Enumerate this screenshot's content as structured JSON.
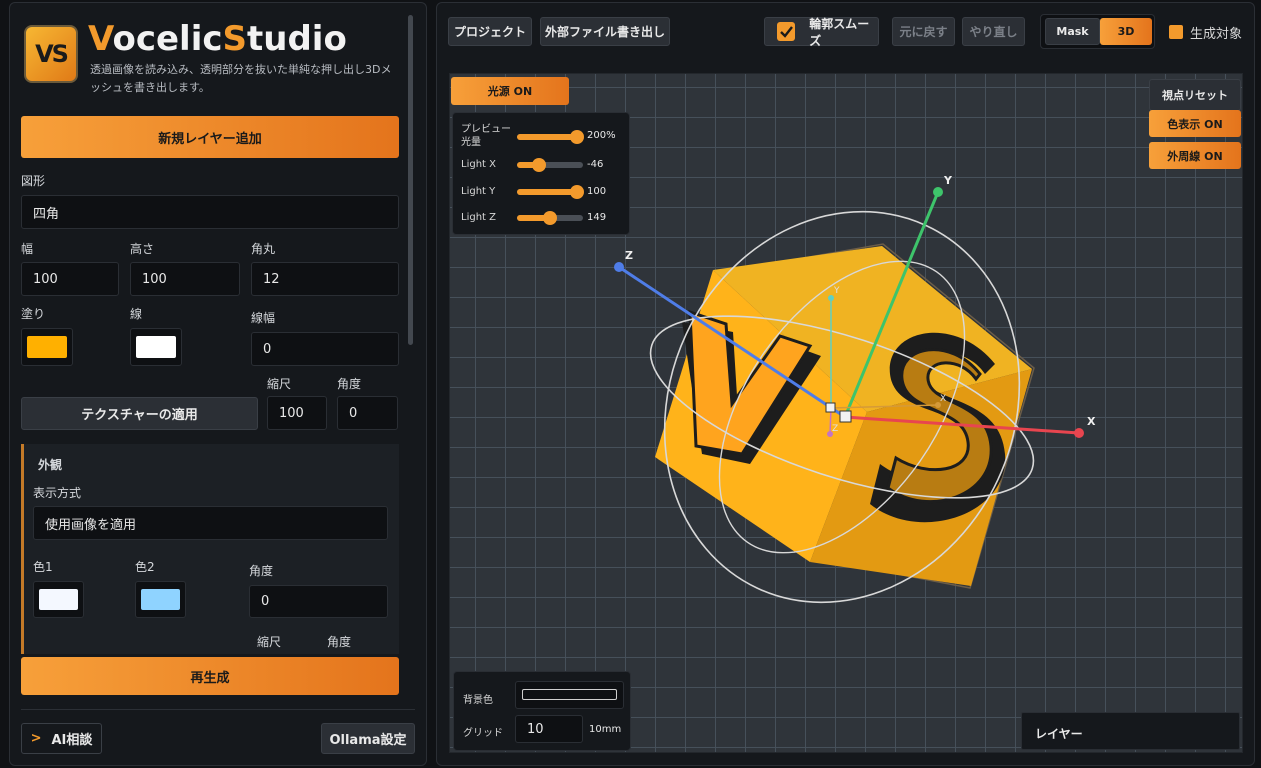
{
  "app": {
    "brand_v": "V",
    "brand_mid": "ocelic",
    "brand_s": "S",
    "brand_end": "tudio",
    "logo_text": "VS",
    "tagline": "透過画像を読み込み、透明部分を抜いた単純な押し出し3Dメッシュを書き出します。"
  },
  "left": {
    "add_layer_button": "新規レイヤー追加",
    "shape_label": "図形",
    "shape_value": "四角",
    "width_label": "幅",
    "width_value": "100",
    "height_label": "高さ",
    "height_value": "100",
    "radius_label": "角丸",
    "radius_value": "12",
    "fill_label": "塗り",
    "stroke_label": "線",
    "stroke_width_label": "線幅",
    "stroke_width_value": "0",
    "scale_label": "縮尺",
    "angle_label": "角度",
    "apply_texture_button": "テクスチャーの適用",
    "texture_scale_value": "100",
    "texture_angle_value": "0",
    "appearance": {
      "title": "外観",
      "display_mode_label": "表示方式",
      "display_mode_value": "使用画像を適用",
      "color1_label": "色1",
      "color2_label": "色2",
      "angle_label": "角度",
      "angle_value": "0",
      "scale_label": "縮尺",
      "angle2_label": "角度"
    },
    "regenerate_button": "再生成",
    "ai_button_prefix": ">",
    "ai_button_label": "AI相談",
    "ollama_button": "Ollama設定"
  },
  "toolbar": {
    "project_button": "プロジェクト",
    "export_button": "外部ファイル書き出し",
    "smooth_label": "輪郭スムーズ",
    "undo_button": "元に戻す",
    "redo_button": "やり直し",
    "mask_button": "Mask",
    "3d_button": "3D",
    "generate_target_label": "生成対象"
  },
  "viewport": {
    "light_toggle": "光源 ON",
    "preview_light_label": "プレビュー光量",
    "preview_light_value": "200%",
    "preview_light_level": 1.0,
    "light_x_label": "Light X",
    "light_x_value": "-46",
    "light_x_level": 0.33,
    "light_y_label": "Light Y",
    "light_y_value": "100",
    "light_y_level": 1.0,
    "light_z_label": "Light Z",
    "light_z_value": "149",
    "light_z_level": 0.5,
    "reset_view_button": "視点リセット",
    "color_display_button": "色表示 ON",
    "outline_button": "外周線 ON",
    "bg_color_label": "背景色",
    "grid_label": "グリッド",
    "grid_value": "10",
    "grid_unit": "10mm",
    "layers_title": "レイヤー",
    "axis_x": "X",
    "axis_y": "Y",
    "axis_z": "Z",
    "axis_x_small": "X",
    "axis_y_small": "Y",
    "axis_z_small": "Z",
    "cube_v": "V",
    "cube_s": "S"
  },
  "colors": {
    "accent": "#f39a2c",
    "fill_swatch": "#ffb000",
    "stroke_swatch": "#ffffff",
    "color1_swatch": "#f4f8ff",
    "color2_swatch": "#8fd3ff",
    "axis_x": "#e8454f",
    "axis_y": "#3ec46b",
    "axis_z": "#4f7de8"
  }
}
